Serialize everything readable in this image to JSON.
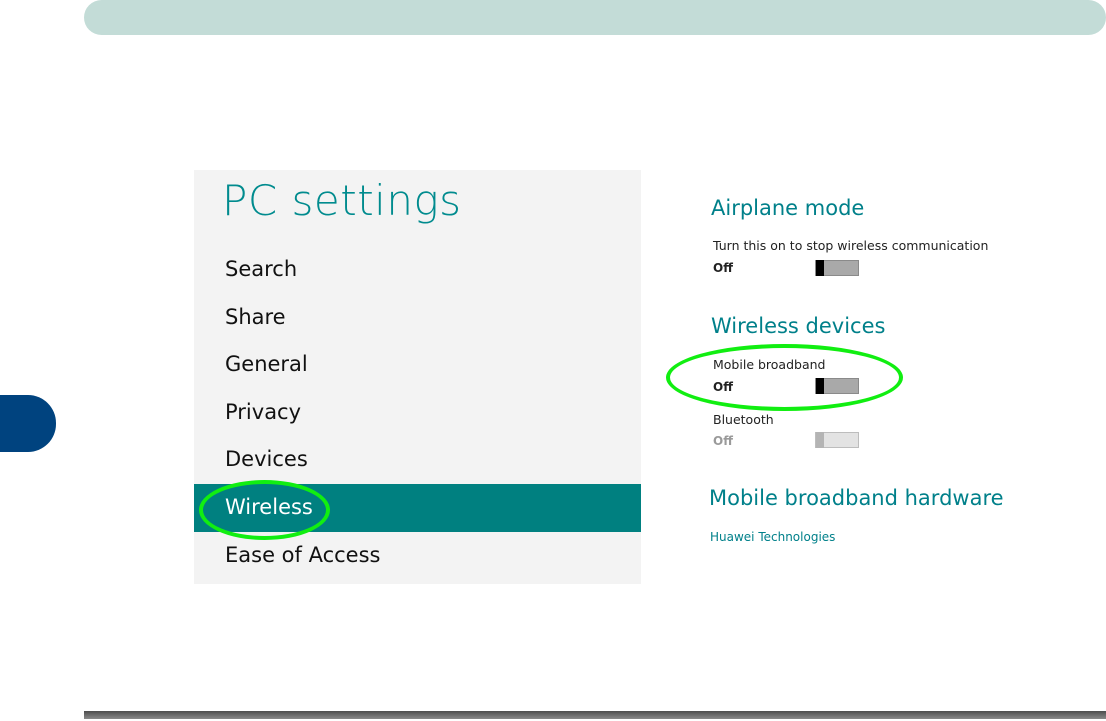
{
  "app_title": "PC settings",
  "nav": {
    "items": [
      {
        "label": "Search"
      },
      {
        "label": "Share"
      },
      {
        "label": "General"
      },
      {
        "label": "Privacy"
      },
      {
        "label": "Devices"
      },
      {
        "label": "Wireless",
        "selected": true
      },
      {
        "label": "Ease of Access"
      }
    ]
  },
  "airplane_mode": {
    "heading": "Airplane mode",
    "description": "Turn this on to stop wireless communication",
    "state": "Off"
  },
  "wireless_devices": {
    "heading": "Wireless devices",
    "mobile_broadband": {
      "label": "Mobile broadband",
      "state": "Off"
    },
    "bluetooth": {
      "label": "Bluetooth",
      "state": "Off",
      "enabled": false
    }
  },
  "mobile_broadband_hardware": {
    "heading": "Mobile broadband hardware",
    "device": "Huawei Technologies"
  },
  "colors": {
    "accent": "#008080",
    "highlight_ellipse": "#11ee11",
    "top_bar": "#c3dcd7",
    "side_tab": "#00437f"
  }
}
